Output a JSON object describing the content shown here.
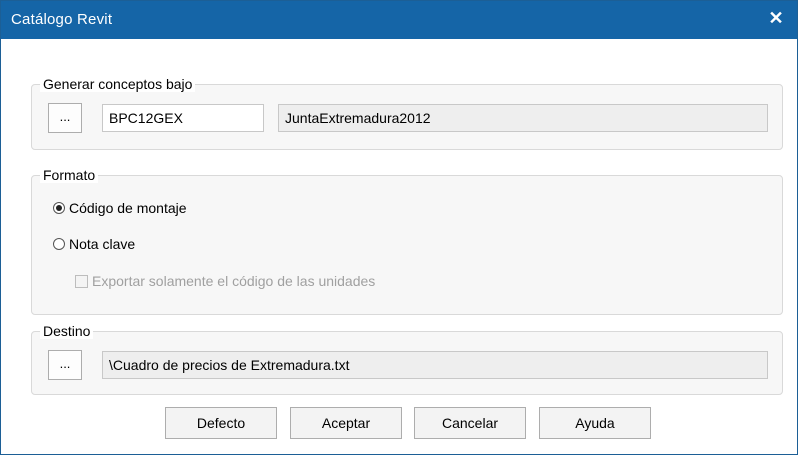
{
  "window": {
    "title": "Catálogo Revit",
    "close_glyph": "✕"
  },
  "group_generar": {
    "legend": "Generar conceptos bajo",
    "browse_label": "...",
    "code_value": "BPC12GEX",
    "name_value": "JuntaExtremadura2012"
  },
  "group_formato": {
    "legend": "Formato",
    "options": [
      {
        "label": "Código de montaje",
        "checked": true
      },
      {
        "label": "Nota clave",
        "checked": false
      }
    ],
    "checkbox": {
      "label": "Exportar solamente el código de las unidades",
      "checked": false,
      "enabled": false
    }
  },
  "group_destino": {
    "legend": "Destino",
    "browse_label": "...",
    "path_value": "\\Cuadro de precios de Extremadura.txt"
  },
  "buttons": {
    "defecto": "Defecto",
    "aceptar": "Aceptar",
    "cancelar": "Cancelar",
    "ayuda": "Ayuda"
  },
  "colors": {
    "titlebar": "#1565a7"
  }
}
